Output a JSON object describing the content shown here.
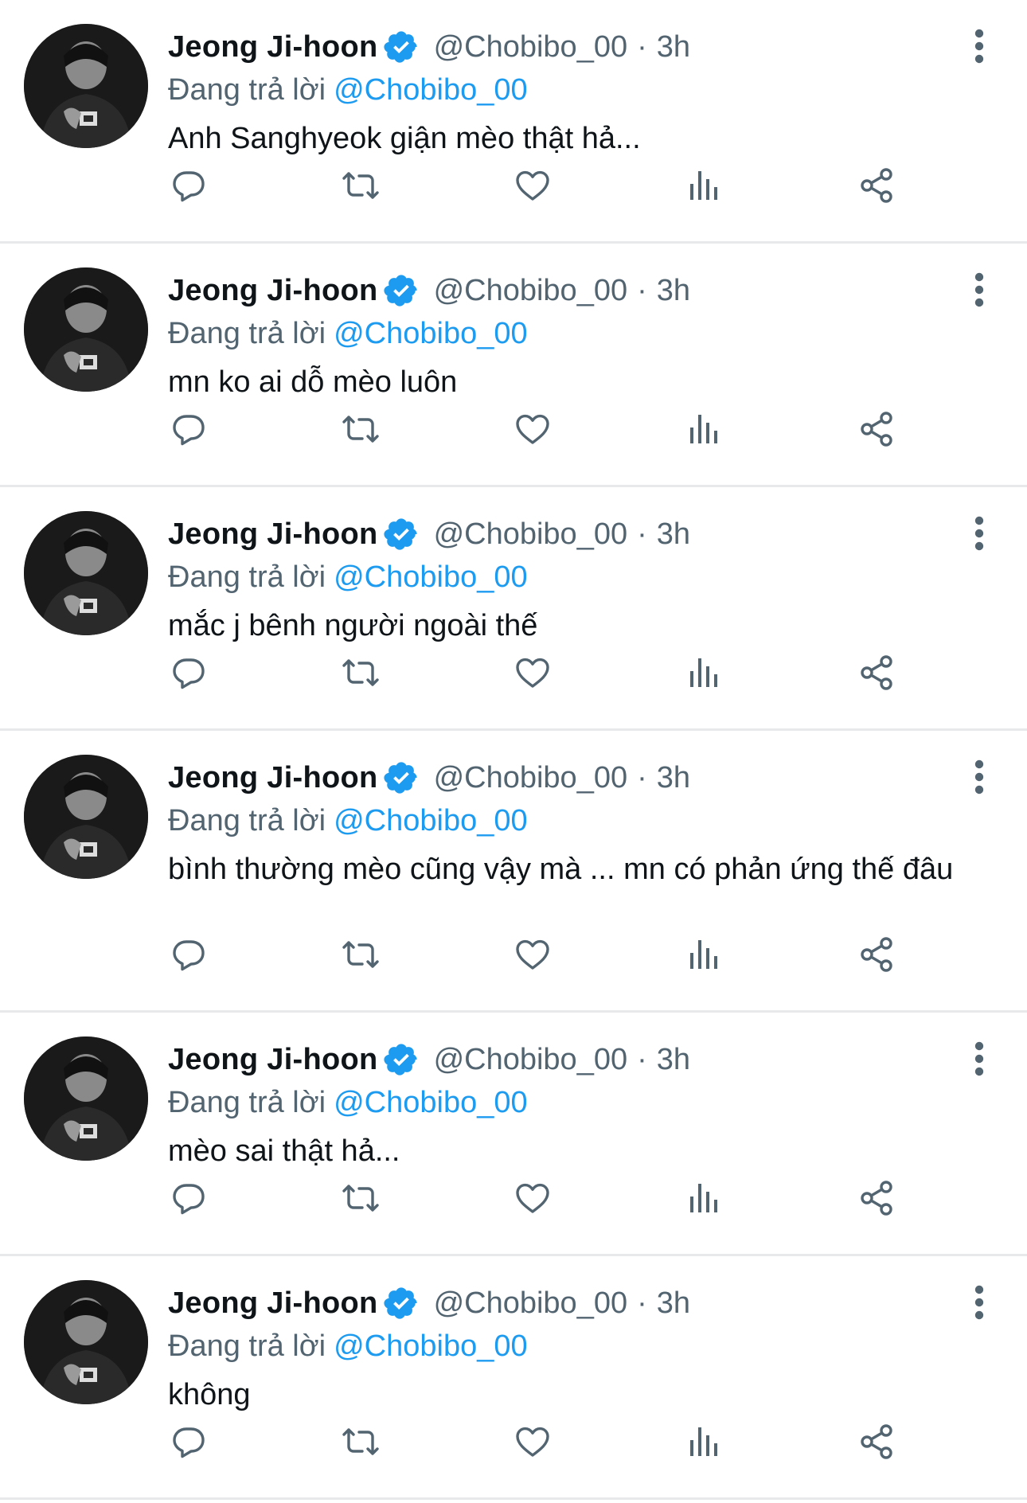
{
  "colors": {
    "text": "#0f1419",
    "secondary": "#536471",
    "accent": "#1d9bf0",
    "divider": "#e7e9ea"
  },
  "icons": {
    "reply": "reply-icon",
    "retweet": "retweet-icon",
    "like": "heart-icon",
    "views": "views-icon",
    "share": "share-icon",
    "more": "more-vertical-icon",
    "verified": "verified-badge-icon"
  },
  "tweets": [
    {
      "name": "Jeong Ji-hoon",
      "handle": "@Chobibo_00",
      "separator": "·",
      "time": "3h",
      "reply_prefix": "Đang trả lời",
      "reply_to": "@Chobibo_00",
      "text": "Anh Sanghyeok giận mèo thật hả..."
    },
    {
      "name": "Jeong Ji-hoon",
      "handle": "@Chobibo_00",
      "separator": "·",
      "time": "3h",
      "reply_prefix": "Đang trả lời",
      "reply_to": "@Chobibo_00",
      "text": "mn ko ai dỗ mèo luôn"
    },
    {
      "name": "Jeong Ji-hoon",
      "handle": "@Chobibo_00",
      "separator": "·",
      "time": "3h",
      "reply_prefix": "Đang trả lời",
      "reply_to": "@Chobibo_00",
      "text": "mắc j bênh người ngoài thế"
    },
    {
      "name": "Jeong Ji-hoon",
      "handle": "@Chobibo_00",
      "separator": "·",
      "time": "3h",
      "reply_prefix": "Đang trả lời",
      "reply_to": "@Chobibo_00",
      "text": "bình thường mèo cũng vậy mà ... mn có phản ứng thế đâu"
    },
    {
      "name": "Jeong Ji-hoon",
      "handle": "@Chobibo_00",
      "separator": "·",
      "time": "3h",
      "reply_prefix": "Đang trả lời",
      "reply_to": "@Chobibo_00",
      "text": "mèo sai thật hả..."
    },
    {
      "name": "Jeong Ji-hoon",
      "handle": "@Chobibo_00",
      "separator": "·",
      "time": "3h",
      "reply_prefix": "Đang trả lời",
      "reply_to": "@Chobibo_00",
      "text": "không"
    }
  ]
}
